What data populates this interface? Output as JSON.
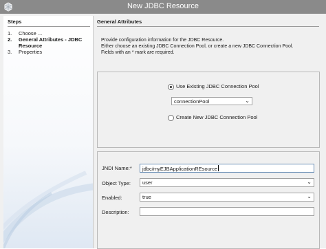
{
  "window": {
    "title": "New JDBC Resource"
  },
  "steps": {
    "header": "Steps",
    "items": [
      {
        "num": "1.",
        "label": "Choose ..."
      },
      {
        "num": "2.",
        "label": "General Attributes - JDBC Resource"
      },
      {
        "num": "3.",
        "label": "Properties"
      }
    ]
  },
  "main": {
    "header": "General Attributes",
    "description": [
      "Provide configuration information for the JDBC Resource.",
      "Either choose an existing JDBC Connection Pool, or create a new JDBC Connection Pool.",
      "Fields with an * mark are required."
    ]
  },
  "pool": {
    "use_existing_label": "Use Existing JDBC Connection Pool",
    "use_existing_selected": true,
    "connection_pool": "connectionPool",
    "create_new_label": "Create New JDBC Connection Pool",
    "create_new_selected": false
  },
  "form": {
    "jndi_label": "JNDI Name:*",
    "jndi_value": "jdbc/myEJBApplicationREsource",
    "object_type_label": "Object Type:",
    "object_type_value": "user",
    "enabled_label": "Enabled:",
    "enabled_value": "true",
    "description_label": "Description:",
    "description_value": ""
  }
}
